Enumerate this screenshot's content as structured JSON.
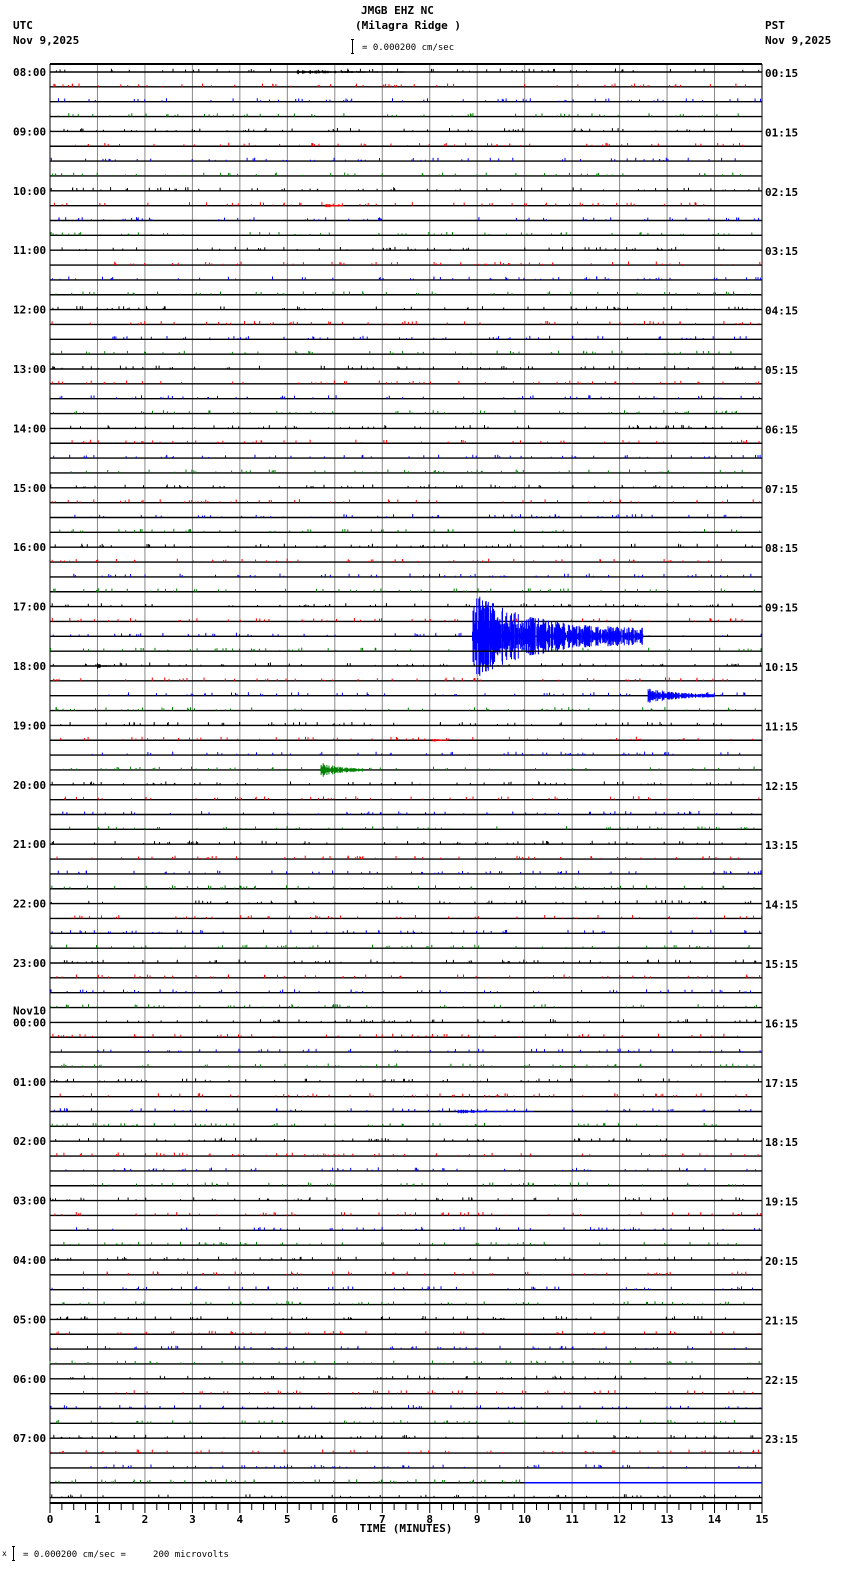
{
  "header": {
    "station": "JMGB EHZ NC",
    "location": "(Milagra Ridge )",
    "left_tz": "UTC",
    "left_date": "Nov 9,2025",
    "right_tz": "PST",
    "right_date": "Nov 9,2025",
    "scale": "= 0.000200 cm/sec"
  },
  "footer": {
    "scale": "= 0.000200 cm/sec =     200 microvolts"
  },
  "chart_data": {
    "type": "line",
    "title": "JMGB EHZ NC (Milagra Ridge )",
    "xlabel": "TIME (MINUTES)",
    "xlim": [
      0,
      15
    ],
    "x_ticks": [
      "0",
      "1",
      "2",
      "3",
      "4",
      "5",
      "6",
      "7",
      "8",
      "9",
      "10",
      "11",
      "12",
      "13",
      "14",
      "15"
    ],
    "traces_per_hour": 4,
    "trace_colors": [
      "#000000",
      "#ff0000",
      "#0000ff",
      "#008000"
    ],
    "left_labels": [
      "08:00",
      "09:00",
      "10:00",
      "11:00",
      "12:00",
      "13:00",
      "14:00",
      "15:00",
      "16:00",
      "17:00",
      "18:00",
      "19:00",
      "20:00",
      "21:00",
      "22:00",
      "23:00",
      "Nov10\n00:00",
      "01:00",
      "02:00",
      "03:00",
      "04:00",
      "05:00",
      "06:00",
      "07:00"
    ],
    "right_labels": [
      "00:15",
      "01:15",
      "02:15",
      "03:15",
      "04:15",
      "05:15",
      "06:15",
      "07:15",
      "08:15",
      "09:15",
      "10:15",
      "11:15",
      "12:15",
      "13:15",
      "14:15",
      "15:15",
      "16:15",
      "17:15",
      "18:15",
      "19:15",
      "20:15",
      "21:15",
      "22:15",
      "23:15"
    ],
    "events": [
      {
        "trace": 0,
        "start_min": 5.2,
        "end_min": 8.5,
        "amplitude": 0.15
      },
      {
        "trace": 9,
        "start_min": 5.8,
        "end_min": 6.2,
        "amplitude": 0.2
      },
      {
        "trace": 38,
        "start_min": 8.9,
        "end_min": 12.5,
        "amplitude": 3.0
      },
      {
        "trace": 40,
        "start_min": 1.0,
        "end_min": 1.3,
        "amplitude": 0.2
      },
      {
        "trace": 42,
        "start_min": 12.6,
        "end_min": 14.0,
        "amplitude": 0.6
      },
      {
        "trace": 45,
        "start_min": 8.05,
        "end_min": 8.4,
        "amplitude": 0.15
      },
      {
        "trace": 47,
        "start_min": 5.7,
        "end_min": 6.6,
        "amplitude": 0.6
      },
      {
        "trace": 70,
        "start_min": 8.6,
        "end_min": 10.2,
        "amplitude": 0.15
      }
    ],
    "last_trace_data_end_min": 10
  }
}
